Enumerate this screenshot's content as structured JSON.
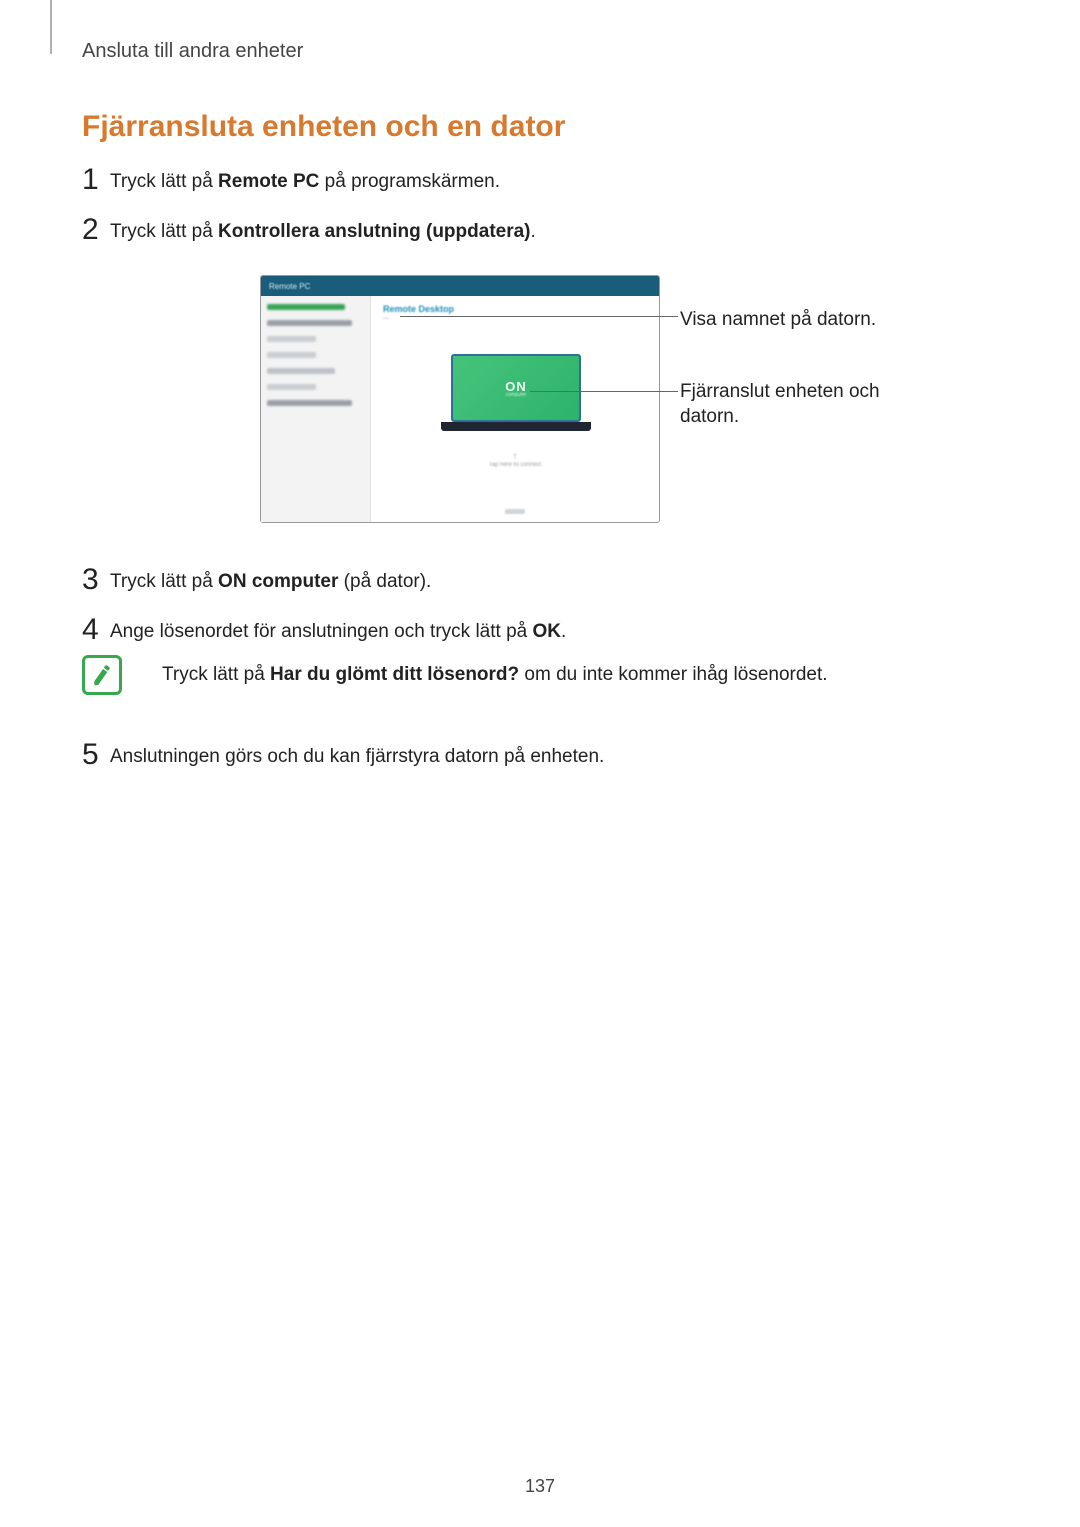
{
  "header": {
    "breadcrumb": "Ansluta till andra enheter"
  },
  "section": {
    "title": "Fjärransluta enheten och en dator"
  },
  "steps": {
    "s1": {
      "num": "1",
      "pre": "Tryck lätt på ",
      "bold": "Remote PC",
      "post": " på programskärmen."
    },
    "s2": {
      "num": "2",
      "pre": "Tryck lätt på ",
      "bold": "Kontrollera anslutning (uppdatera)",
      "post": "."
    },
    "s3": {
      "num": "3",
      "pre": "Tryck lätt på ",
      "bold": "ON computer",
      "post": " (på dator)."
    },
    "s4": {
      "num": "4",
      "pre": "Ange lösenordet för anslutningen och tryck lätt på ",
      "bold": "OK",
      "post": "."
    },
    "s5": {
      "num": "5",
      "text": "Anslutningen görs och du kan fjärrstyra datorn på enheten."
    }
  },
  "note": {
    "pre": "Tryck lätt på ",
    "bold": "Har du glömt ditt lösenord?",
    "post": " om du inte kommer ihåg lösenordet."
  },
  "callouts": {
    "c1": "Visa namnet på datorn.",
    "c2": "Fjärranslut enheten och datorn."
  },
  "figure": {
    "topbar": "Remote PC",
    "sidebar_top": "Remote Desktop",
    "laptop_label": "ON",
    "laptop_sub": "computer",
    "under_arrow": "↑",
    "under_text": "Tap here to connect"
  },
  "pageNumber": "137"
}
